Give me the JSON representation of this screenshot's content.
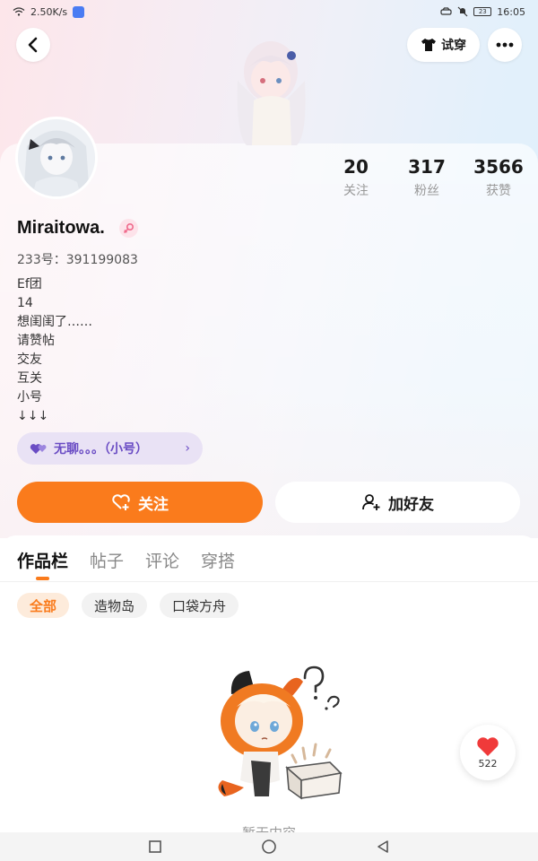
{
  "status_bar": {
    "net_speed": "2.50K/s",
    "battery": "23",
    "time": "16:05"
  },
  "header": {
    "tryon_label": "试穿",
    "back_icon": "chevron-left-icon",
    "more_icon": "more-dots-icon"
  },
  "stats": [
    {
      "value": "20",
      "label": "关注"
    },
    {
      "value": "317",
      "label": "粉丝"
    },
    {
      "value": "3566",
      "label": "获赞"
    }
  ],
  "profile": {
    "username": "Miraitowa.",
    "gender": "female",
    "uid_text": "233号：391199083",
    "bio_lines": [
      "Ef团",
      "14",
      "想闺闺了……",
      "请赞帖",
      "交友",
      "互关",
      "小号",
      "↓↓↓"
    ],
    "linked_account": "无聊。。。（小号）"
  },
  "actions": {
    "follow_label": "关注",
    "addfriend_label": "加好友"
  },
  "tabs": [
    {
      "label": "作品栏",
      "active": true
    },
    {
      "label": "帖子",
      "active": false
    },
    {
      "label": "评论",
      "active": false
    },
    {
      "label": "穿搭",
      "active": false
    }
  ],
  "filters": [
    {
      "label": "全部",
      "active": true
    },
    {
      "label": "造物岛",
      "active": false
    },
    {
      "label": "口袋方舟",
      "active": false
    }
  ],
  "empty_state": {
    "text": "暂无内容"
  },
  "fab": {
    "count": "522"
  },
  "colors": {
    "accent": "#fa7b1c",
    "linked_bg": "#e9e2f5",
    "linked_text": "#6a4cc4"
  }
}
